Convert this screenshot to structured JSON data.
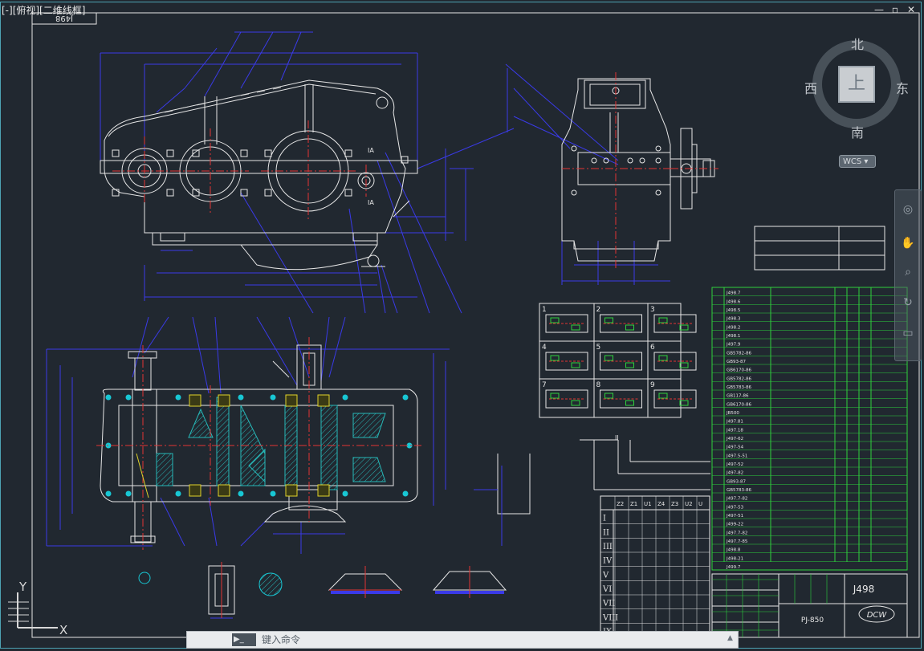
{
  "viewport": {
    "label": "[-][俯视][二维线框]",
    "title_block_ref": "J498"
  },
  "window_buttons": [
    "—",
    "▫",
    "✕"
  ],
  "viewcube": {
    "top_face": "上",
    "north": "北",
    "south": "南",
    "east": "东",
    "west": "西",
    "wcs_label": "WCS"
  },
  "ucs": {
    "y_label": "Y",
    "x_label": "X"
  },
  "command_line": {
    "prompt_button": "▶_",
    "placeholder": "键入命令",
    "close_icon": "✕",
    "settings_icon": "🔧"
  },
  "title_block": {
    "drawing_no": "J498",
    "model": "PJ-850",
    "logo": "DCW"
  },
  "gear_table": {
    "headers": [
      "Z2",
      "Z1",
      "U1",
      "Z4",
      "Z3",
      "U2",
      "U"
    ],
    "rows": [
      "I",
      "II",
      "III",
      "IV",
      "V",
      "VI",
      "VII",
      "VIII",
      "IX"
    ]
  },
  "views_grid": [
    "1",
    "2",
    "3",
    "4",
    "5",
    "6",
    "7",
    "8",
    "9"
  ],
  "parts_list": [
    "J498.7",
    "J498.6",
    "J498.5",
    "J498.3",
    "J498.2",
    "J498.1",
    "J497.9",
    "GB5782-86",
    "GB93-87",
    "GB6170-86",
    "GB5782-86",
    "GB5783-86",
    "GB117-86",
    "GB6170-86",
    "JB500",
    "J497.81",
    "J497.18",
    "J497-62",
    "J497-54",
    "J497.5-51",
    "J497-52",
    "J497-82",
    "GB93-87",
    "GB5783-86",
    "J497.7-82",
    "J497-53",
    "J497-51",
    "J499-22",
    "J497.7-82",
    "J497.7-85",
    "J498.8",
    "J498-21",
    "J499.7"
  ],
  "colors": {
    "background": "#212830",
    "border": "#4da3b3",
    "outline": "#e6e6e6",
    "dimension": "#3a3ae8",
    "centerline": "#e23333",
    "hidden": "#e23333",
    "table_line": "#2ed13d",
    "accent": "#18c7d4",
    "hatch": "#27b8b8",
    "yellow": "#e0d22a"
  }
}
